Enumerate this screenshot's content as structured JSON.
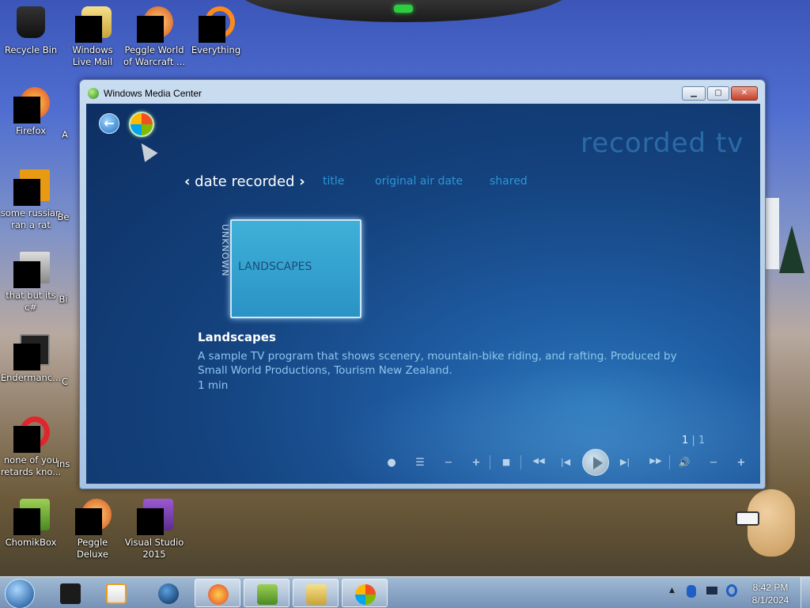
{
  "desktop": {
    "icons": [
      {
        "label": "Recycle Bin",
        "icon": "recycle-bin-icon"
      },
      {
        "label": "Windows Live Mail",
        "icon": "windows-live-mail-icon"
      },
      {
        "label": "Peggle World of Warcraft ...",
        "icon": "peggle-icon"
      },
      {
        "label": "Everything",
        "icon": "everything-search-icon"
      },
      {
        "label": "Firefox",
        "icon": "firefox-icon"
      },
      {
        "label": "some russian ran a rat",
        "icon": "app-icon"
      },
      {
        "label": "that but its c#",
        "icon": "app-icon"
      },
      {
        "label": "Endermanc...",
        "icon": "app-icon"
      },
      {
        "label": "none of you retards kno...",
        "icon": "opera-icon"
      },
      {
        "label": "ChomikBox",
        "icon": "chomikbox-icon"
      },
      {
        "label": "Peggle Deluxe",
        "icon": "peggle-icon"
      },
      {
        "label": "Visual Studio 2015",
        "icon": "visual-studio-icon"
      }
    ],
    "partial_labels": [
      "A",
      "Be",
      "Bi",
      "C",
      "Ins"
    ]
  },
  "window": {
    "title": "Windows Media Center",
    "minimize": "▁",
    "maximize": "▢",
    "close": "✕"
  },
  "mediacenter": {
    "page_heading": "recorded tv",
    "sort_tabs": [
      {
        "label": "date recorded",
        "selected": true
      },
      {
        "label": "title",
        "selected": false
      },
      {
        "label": "original air date",
        "selected": false
      },
      {
        "label": "shared",
        "selected": false
      }
    ],
    "group_label": "UNKNOWN",
    "tile_label": "LANDSCAPES",
    "program": {
      "title": "Landscapes",
      "description": "A sample TV program that shows scenery, mountain-bike riding, and rafting. Produced by Small World Productions, Tourism New Zealand.",
      "duration": "1 min"
    },
    "pager": {
      "current": "1",
      "total": "1"
    },
    "transport": {
      "record": "●",
      "guide": "☰",
      "channel_down": "−",
      "channel_up": "+",
      "stop": "■",
      "rewind": "◀◀",
      "skip_back": "|◀",
      "skip_forward": "▶|",
      "fast_forward": "▶▶",
      "volume": "🔊",
      "volume_down": "−",
      "volume_up": "+"
    }
  },
  "taskbar": {
    "items": [
      "game-console-icon",
      "media-player-icon",
      "globe-icon",
      "firefox-icon",
      "chomikbox-icon",
      "explorer-icon",
      "media-center-icon"
    ],
    "active_items": [
      "firefox-icon",
      "chomikbox-icon",
      "explorer-icon",
      "media-center-icon"
    ],
    "clock_time": "8:42 PM",
    "clock_date": "8/1/2024",
    "tray_chevron": "▲"
  }
}
